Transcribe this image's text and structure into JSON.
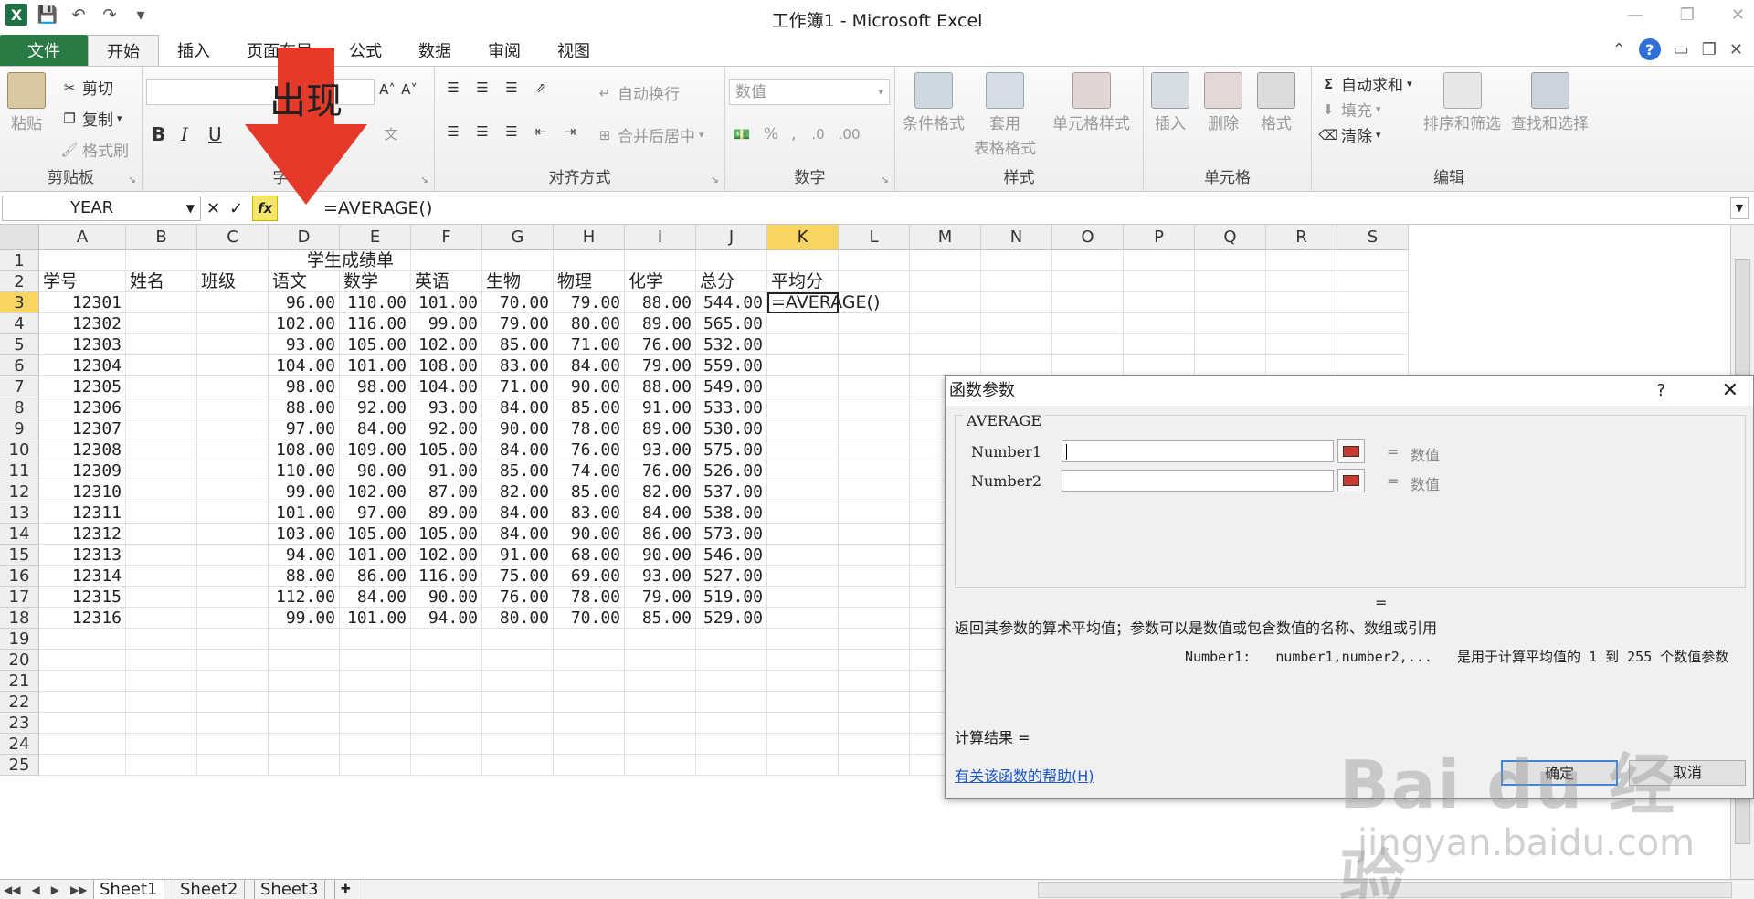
{
  "window": {
    "title": "工作簿1 - Microsoft Excel"
  },
  "tabs": [
    "文件",
    "开始",
    "插入",
    "页面布局",
    "公式",
    "数据",
    "审阅",
    "视图"
  ],
  "ribbon": {
    "clipboard": {
      "paste": "粘贴",
      "cut": "剪切",
      "copy": "复制",
      "format_painter": "格式刷",
      "label": "剪贴板"
    },
    "font": {
      "label": "字体",
      "bold": "B",
      "italic": "I",
      "underline": "U"
    },
    "alignment": {
      "wrap": "自动换行",
      "merge": "合并后居中",
      "label": "对齐方式"
    },
    "number": {
      "format": "数值",
      "percent": "%",
      "comma": ",",
      "label": "数字"
    },
    "styles": {
      "conditional": "条件格式",
      "table_format_1": "套用",
      "table_format_2": "表格格式",
      "cell_styles": "单元格样式",
      "label": "样式"
    },
    "cells": {
      "insert": "插入",
      "delete": "删除",
      "format": "格式",
      "label": "单元格"
    },
    "editing": {
      "autosum": "自动求和",
      "fill": "填充",
      "clear": "清除",
      "sort_filter": "排序和筛选",
      "find_select": "查找和选择",
      "label": "编辑"
    }
  },
  "annotation": {
    "arrow_text": "出现"
  },
  "formula_bar": {
    "name_box": "YEAR",
    "formula": "=AVERAGE()"
  },
  "sheet": {
    "columns": [
      "A",
      "B",
      "C",
      "D",
      "E",
      "F",
      "G",
      "H",
      "I",
      "J",
      "K",
      "L",
      "M",
      "N",
      "O",
      "P",
      "Q",
      "R",
      "S"
    ],
    "row_numbers": [
      "1",
      "2",
      "3",
      "4",
      "5",
      "6",
      "7",
      "8",
      "9",
      "10",
      "11",
      "12",
      "13",
      "14",
      "15",
      "16",
      "17",
      "18",
      "19",
      "20",
      "21",
      "22",
      "23",
      "24",
      "25"
    ],
    "title": "学生成绩单",
    "headers": [
      "学号",
      "姓名",
      "班级",
      "语文",
      "数学",
      "英语",
      "生物",
      "物理",
      "化学",
      "总分",
      "平均分"
    ],
    "rows": [
      [
        "12301",
        "96.00",
        "110.00",
        "101.00",
        "70.00",
        "79.00",
        "88.00",
        "544.00"
      ],
      [
        "12302",
        "102.00",
        "116.00",
        "99.00",
        "79.00",
        "80.00",
        "89.00",
        "565.00"
      ],
      [
        "12303",
        "93.00",
        "105.00",
        "102.00",
        "85.00",
        "71.00",
        "76.00",
        "532.00"
      ],
      [
        "12304",
        "104.00",
        "101.00",
        "108.00",
        "83.00",
        "84.00",
        "79.00",
        "559.00"
      ],
      [
        "12305",
        "98.00",
        "98.00",
        "104.00",
        "71.00",
        "90.00",
        "88.00",
        "549.00"
      ],
      [
        "12306",
        "88.00",
        "92.00",
        "93.00",
        "84.00",
        "85.00",
        "91.00",
        "533.00"
      ],
      [
        "12307",
        "97.00",
        "84.00",
        "92.00",
        "90.00",
        "78.00",
        "89.00",
        "530.00"
      ],
      [
        "12308",
        "108.00",
        "109.00",
        "105.00",
        "84.00",
        "76.00",
        "93.00",
        "575.00"
      ],
      [
        "12309",
        "110.00",
        "90.00",
        "91.00",
        "85.00",
        "74.00",
        "76.00",
        "526.00"
      ],
      [
        "12310",
        "99.00",
        "102.00",
        "87.00",
        "82.00",
        "85.00",
        "82.00",
        "537.00"
      ],
      [
        "12311",
        "101.00",
        "97.00",
        "89.00",
        "84.00",
        "83.00",
        "84.00",
        "538.00"
      ],
      [
        "12312",
        "103.00",
        "105.00",
        "105.00",
        "84.00",
        "90.00",
        "86.00",
        "573.00"
      ],
      [
        "12313",
        "94.00",
        "101.00",
        "102.00",
        "91.00",
        "68.00",
        "90.00",
        "546.00"
      ],
      [
        "12314",
        "88.00",
        "86.00",
        "116.00",
        "75.00",
        "69.00",
        "93.00",
        "527.00"
      ],
      [
        "12315",
        "112.00",
        "84.00",
        "90.00",
        "76.00",
        "78.00",
        "79.00",
        "519.00"
      ],
      [
        "12316",
        "99.00",
        "101.00",
        "94.00",
        "80.00",
        "70.00",
        "85.00",
        "529.00"
      ]
    ],
    "active_cell_text": "=AVERAGE()"
  },
  "sheet_tabs": [
    "Sheet1",
    "Sheet2",
    "Sheet3"
  ],
  "dialog": {
    "title": "函数参数",
    "help": "?",
    "close": "✕",
    "function_name": "AVERAGE",
    "args": [
      {
        "label": "Number1",
        "result": "数值"
      },
      {
        "label": "Number2",
        "result": "数值"
      }
    ],
    "eq_sign": "=",
    "description": "返回其参数的算术平均值；参数可以是数值或包含数值的名称、数组或引用",
    "arg_help_label": "Number1:",
    "arg_help_syntax": "number1,number2,...",
    "arg_help_text": "是用于计算平均值的 1 到 255 个数值参数",
    "result_label": "计算结果 =",
    "help_link": "有关该函数的帮助(H)",
    "ok": "确定",
    "cancel": "取消"
  },
  "watermark": {
    "main": "Bai du 经验",
    "sub": "jingyan.baidu.com"
  }
}
